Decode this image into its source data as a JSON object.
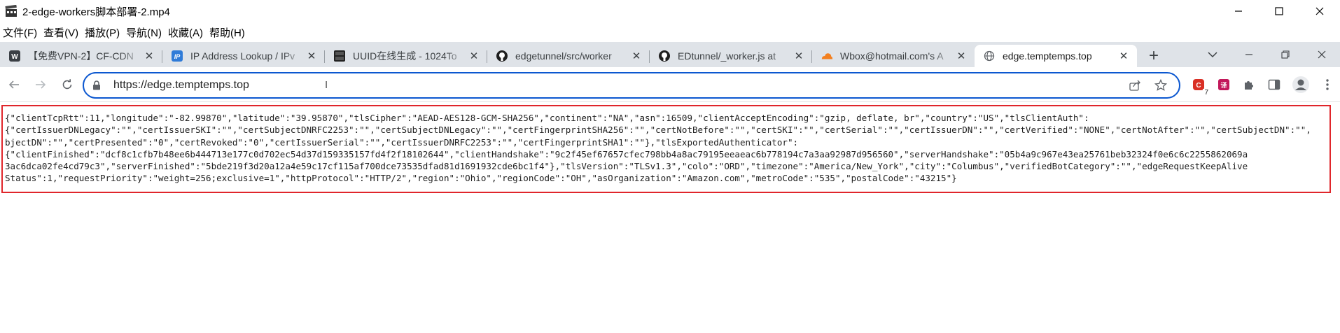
{
  "player": {
    "title": "2-edge-workers脚本部署-2.mp4",
    "menu": [
      "文件(F)",
      "查看(V)",
      "播放(P)",
      "导航(N)",
      "收藏(A)",
      "帮助(H)"
    ]
  },
  "browser": {
    "tabs": [
      {
        "label": "【免费VPN-2】CF-CDN",
        "icon": "worker-icon"
      },
      {
        "label": "IP Address Lookup / IPv",
        "icon": "ip-icon"
      },
      {
        "label": "UUID在线生成 - 1024To",
        "icon": "tool-icon"
      },
      {
        "label": "edgetunnel/src/worker",
        "icon": "github-icon"
      },
      {
        "label": "EDtunnel/_worker.js at",
        "icon": "github-icon"
      },
      {
        "label": "Wbox@hotmail.com's A",
        "icon": "cloudflare-icon"
      },
      {
        "label": "edge.temptemps.top",
        "icon": "globe-icon",
        "active": true
      }
    ],
    "url": "https://edge.temptemps.top",
    "extension_badge": "7",
    "colors": {
      "accent": "#0b57d0",
      "highlight_border": "#e0262b",
      "tabstrip": "#dfe3e8"
    }
  },
  "page": {
    "lines": [
      "{\"clientTcpRtt\":11,\"longitude\":\"-82.99870\",\"latitude\":\"39.95870\",\"tlsCipher\":\"AEAD-AES128-GCM-SHA256\",\"continent\":\"NA\",\"asn\":16509,\"clientAcceptEncoding\":\"gzip, deflate, br\",\"country\":\"US\",\"tlsClientAuth\":",
      "{\"certIssuerDNLegacy\":\"\",\"certIssuerSKI\":\"\",\"certSubjectDNRFC2253\":\"\",\"certSubjectDNLegacy\":\"\",\"certFingerprintSHA256\":\"\",\"certNotBefore\":\"\",\"certSKI\":\"\",\"certSerial\":\"\",\"certIssuerDN\":\"\",\"certVerified\":\"NONE\",\"certNotAfter\":\"\",\"certSubjectDN\":\"\",",
      "bjectDN\":\"\",\"certPresented\":\"0\",\"certRevoked\":\"0\",\"certIssuerSerial\":\"\",\"certIssuerDNRFC2253\":\"\",\"certFingerprintSHA1\":\"\"},\"tlsExportedAuthenticator\":",
      "{\"clientFinished\":\"dcf8c1cfb7b48ee6b444713e177c0d702ec54d37d159335157fd4f2f18102644\",\"clientHandshake\":\"9c2f45ef67657cfec798bb4a8ac79195eeaeac6b778194c7a3aa92987d956560\",\"serverHandshake\":\"05b4a9c967e43ea25761beb32324f0e6c6c2255862069a",
      "3ac6dca02fe4cd79c3\",\"serverFinished\":\"5bde219f3d20a12a4e59c17cf115af700dce73535dfad81d1691932cde6bc1f4\"},\"tlsVersion\":\"TLSv1.3\",\"colo\":\"ORD\",\"timezone\":\"America/New_York\",\"city\":\"Columbus\",\"verifiedBotCategory\":\"\",\"edgeRequestKeepAlive",
      "Status\":1,\"requestPriority\":\"weight=256;exclusive=1\",\"httpProtocol\":\"HTTP/2\",\"region\":\"Ohio\",\"regionCode\":\"OH\",\"asOrganization\":\"Amazon.com\",\"metroCode\":\"535\",\"postalCode\":\"43215\"}"
    ]
  }
}
